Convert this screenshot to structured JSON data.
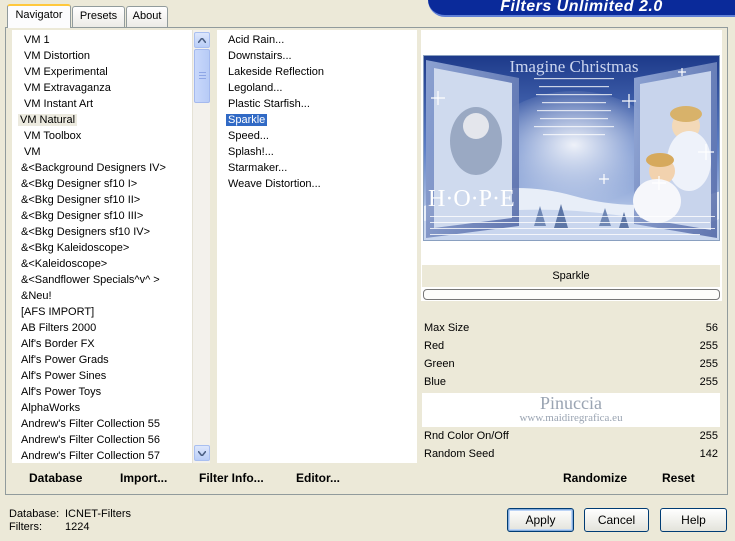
{
  "title": "Filters Unlimited 2.0",
  "tabs": [
    {
      "label": "Navigator"
    },
    {
      "label": "Presets"
    },
    {
      "label": "About"
    }
  ],
  "categories": {
    "items": [
      "VM 1",
      "VM Distortion",
      "VM Experimental",
      "VM Extravaganza",
      "VM Instant Art",
      "VM Natural",
      "VM Toolbox",
      "VM",
      "&<Background Designers IV>",
      "&<Bkg Designer sf10 I>",
      "&<Bkg Designer sf10 II>",
      "&<Bkg Designer sf10 III>",
      "&<Bkg Designers sf10 IV>",
      "&<Bkg Kaleidoscope>",
      "&<Kaleidoscope>",
      "&<Sandflower Specials^v^ >",
      "&Neu!",
      "[AFS IMPORT]",
      "AB Filters 2000",
      "Alf's Border FX",
      "Alf's Power Grads",
      "Alf's Power Sines",
      "Alf's Power Toys",
      "AlphaWorks",
      "Andrew's Filter Collection 55",
      "Andrew's Filter Collection 56",
      "Andrew's Filter Collection 57"
    ],
    "selected": "VM Natural"
  },
  "filters": {
    "items": [
      "Acid Rain...",
      "Downstairs...",
      "Lakeside Reflection",
      "Legoland...",
      "Plastic Starfish...",
      "Sparkle",
      "Speed...",
      "Splash!...",
      "Starmaker...",
      "Weave Distortion..."
    ],
    "selected": "Sparkle"
  },
  "bottom_links": {
    "database": "Database",
    "import": "Import...",
    "filter_info": "Filter Info...",
    "editor": "Editor..."
  },
  "preview": {
    "filter_name": "Sparkle",
    "image_title": "Imagine Christmas",
    "image_word": "H·O·P·E",
    "watermark_name": "Pinuccia",
    "watermark_url": "www.maidiregrafica.eu"
  },
  "params": [
    {
      "label": "Max Size",
      "value": "56"
    },
    {
      "label": "Red",
      "value": "255"
    },
    {
      "label": "Green",
      "value": "255"
    },
    {
      "label": "Blue",
      "value": "255"
    },
    {
      "label": "Rnd Color On/Off",
      "value": "255"
    },
    {
      "label": "Random Seed",
      "value": "142"
    }
  ],
  "param_actions": {
    "randomize": "Randomize",
    "reset": "Reset"
  },
  "status": {
    "database_label": "Database:",
    "database_value": "ICNET-Filters",
    "filters_label": "Filters:",
    "filters_value": "1224"
  },
  "buttons": {
    "apply": "Apply",
    "cancel": "Cancel",
    "help": "Help"
  },
  "colors": {
    "banner": "#0a2a9a",
    "selection": "#316ac5",
    "window": "#ece9d8"
  }
}
